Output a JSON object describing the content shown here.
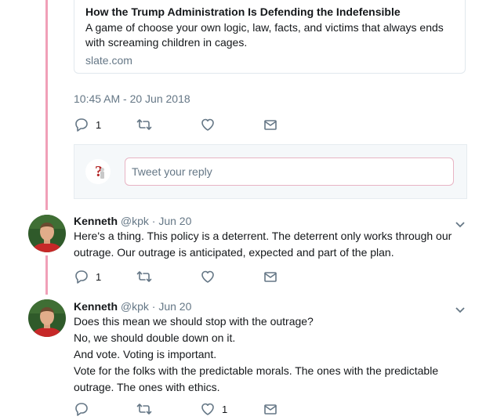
{
  "link_card": {
    "title": "How the Trump Administration Is Defending the Indefensible",
    "description": "A game of choose your own logic, law, facts, and victims that always ends with screaming children in cages.",
    "domain": "slate.com"
  },
  "main_tweet": {
    "timestamp": "10:45 AM - 20 Jun 2018",
    "reply_count": "1",
    "retweet_count": "",
    "like_count": ""
  },
  "reply_box": {
    "placeholder": "Tweet your reply"
  },
  "tweets": [
    {
      "name": "Kenneth",
      "handle": "@kpk",
      "separator": "·",
      "date": "Jun 20",
      "lines": [
        "Here's a thing. This policy is a deterrent. The deterrent only works through our outrage. Our outrage is anticipated, expected and part of the plan."
      ],
      "reply_count": "1",
      "retweet_count": "",
      "like_count": ""
    },
    {
      "name": "Kenneth",
      "handle": "@kpk",
      "separator": "·",
      "date": "Jun 20",
      "lines": [
        "Does this mean we should stop with the outrage?",
        "No, we should double down on it.",
        "And vote. Voting is important.",
        "Vote for the folks with the predictable morals. The ones with the predictable outrage. The ones with ethics."
      ],
      "reply_count": "",
      "retweet_count": "",
      "like_count": "1"
    }
  ],
  "icons": {
    "reply": "reply-icon",
    "retweet": "retweet-icon",
    "like": "heart-icon",
    "dm": "envelope-icon",
    "more": "chevron-down-icon"
  },
  "colors": {
    "thread_line": "#f0a0b8",
    "muted_text": "#657786",
    "card_border": "#e1e8ed",
    "reply_box_bg": "#f5f8fa"
  }
}
